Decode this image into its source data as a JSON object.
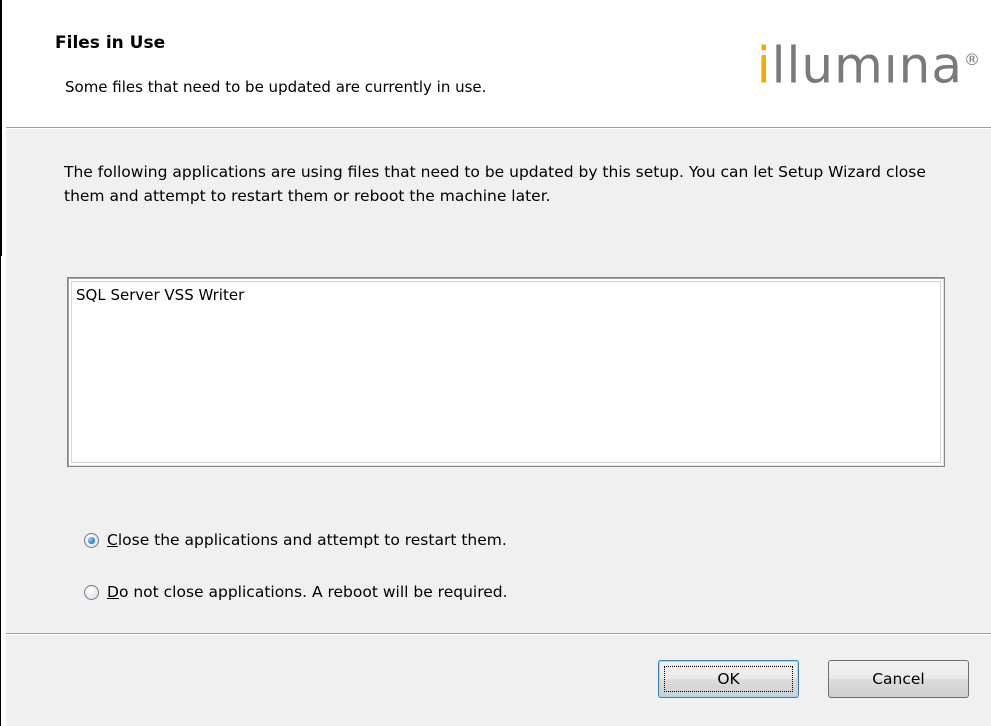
{
  "header": {
    "title": "Files in Use",
    "subtitle": "Some files that need to be updated are currently in use."
  },
  "logo": {
    "first_letter": "i",
    "rest": "llumına",
    "registered_mark": "®",
    "colors": {
      "accent": "#f3a800",
      "gray": "#7a7a7a"
    }
  },
  "description": "The following applications are using files that need to be updated by this setup. You can let Setup Wizard close them and attempt to restart them or reboot the machine later.",
  "applications": [
    "SQL Server VSS Writer"
  ],
  "options": [
    {
      "mnemonic": "C",
      "label_rest": "lose the applications and attempt to restart them.",
      "checked": true
    },
    {
      "mnemonic": "D",
      "label_rest": "o not close applications. A reboot will be required.",
      "checked": false
    }
  ],
  "buttons": {
    "ok": "OK",
    "cancel": "Cancel"
  }
}
